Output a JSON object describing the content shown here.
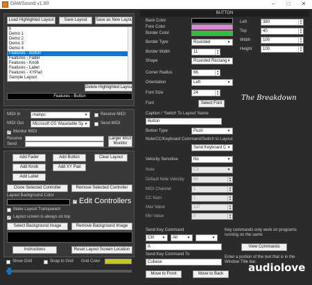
{
  "window": {
    "title": "DAWSound  v1.00",
    "minimize": "–",
    "maximize": "□",
    "close": "✕"
  },
  "left": {
    "load_button": "Load Highlighted Layout",
    "save_button": "Save Layout",
    "save_new_button": "Save as New Layout",
    "layouts": [
      "b",
      "Demo 1",
      "Demo 2",
      "Demo 3",
      "Demo 4",
      "Features - Button",
      "Features - Fader",
      "Features - Knob",
      "Features - Label",
      "Features - XYPad",
      "Sample Layout"
    ],
    "selected_layout_index": 5,
    "delete_button": "Delete Highlighted Layout",
    "status_text": "Features - Button",
    "midi_in_label": "MIDI In",
    "midi_in_value": "mainpc",
    "receive_midi_label": "Receive MIDI",
    "midi_out_label": "MIDI Out",
    "midi_out_value": "Microsoft GS Wavetable Sy",
    "send_midi_label": "Send MIDI",
    "monitor_midi_label": "Monitor MIDI",
    "receive_label": "Receive",
    "send_label": "Send",
    "larger_monitor_button": "Larger MIDI Monitor",
    "add_fader": "Add Fader",
    "add_button": "Add Button",
    "clear_layout": "Clear Layout",
    "add_knob": "Add Knob",
    "add_xypad": "Add XY Pad",
    "add_label": "Add Label",
    "clone_selected": "Clone Selected Controller",
    "remove_selected": "Remove Selected Controller",
    "layout_bg_label": "Layout Background Color",
    "make_transparent_label": "Make Layout Transparent",
    "edit_controllers_label": "Edit Controllers",
    "always_on_top_label": "Layout screen is always on top",
    "select_bg_image": "Select Background Image",
    "remove_bg_image": "Remove Background Image",
    "instructions": "Instructions",
    "reset_location": "Reset Layout Screen Location",
    "show_grid_label": "Show Grid",
    "snap_to_grid_label": "Snap to Grid",
    "grid_color_label": "Grid Color",
    "grid_color": "#c7c72a"
  },
  "right": {
    "header": "BUTTON",
    "back_color_label": "Back Color",
    "back_color": "#000000",
    "fore_color_label": "Fore Color",
    "fore_color": "#d98ad9",
    "border_color_label": "Border Color",
    "border_color": "#2fbf3a",
    "border_type_label": "Border Type",
    "border_type_value": "Rounded",
    "border_width_label": "Border Width",
    "border_width_value": "11",
    "shape_label": "Shape",
    "shape_value": "Rounded Rectang",
    "corner_radius_label": "Corner Radius",
    "corner_radius_value": "66",
    "orientation_label": "Orientation",
    "orientation_value": "Left",
    "font_size_label": "Font Size",
    "font_size_value": "24",
    "font_label": "Font",
    "select_font_button": "Select Font",
    "left_label": "Left",
    "left_value": "380",
    "top_label": "Top",
    "top_value": "40",
    "width_label": "Width",
    "width_value": "100",
    "height_label": "Height",
    "height_value": "100",
    "preview_text": "The Breakdown",
    "caption_label": "Caption / 'Switch To Layout' Name",
    "caption_value": "Button",
    "button_type_label": "Button Type",
    "button_type_value": "Push",
    "note_cc_label": "Note/CC/Keyboard Command/Switch to Layout",
    "note_cc_value": "Send Keyboard C",
    "velocity_sensitive_label": "Velocity Sensitive",
    "velocity_sensitive_value": "No",
    "note_label": "Note",
    "note_value": "C3",
    "default_velocity_label": "Default Note Velocity",
    "default_velocity_value": "64",
    "midi_channel_label": "MIDI Channel",
    "midi_channel_value": "1",
    "cc_num_label": "CC Num",
    "cc_num_value": "1",
    "max_value_label": "Max Value",
    "max_value_value": "127",
    "min_value_label": "Min Value",
    "min_value_value": "0",
    "send_key_label": "Send Key Command",
    "key_mod1": "Ctrl",
    "key_mod2": "Alt",
    "key_mod3": "",
    "key_info": "Key commands only work on programs running on the same",
    "key_value": "A",
    "view_commands": "View Commands",
    "send_key_to_label": "Send Key Command To",
    "send_key_to_value": "Cubase",
    "send_key_to_info": "Enter a portion of the text that is in the Window Title bar.",
    "move_front": "Move to Front",
    "move_back": "Move to Back"
  },
  "watermark": "audiolove"
}
